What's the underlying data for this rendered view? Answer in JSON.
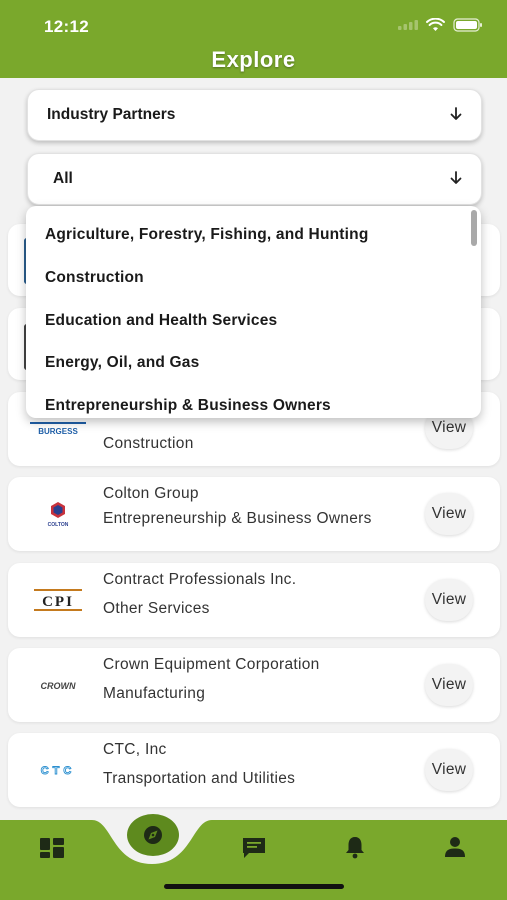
{
  "status": {
    "time": "12:12"
  },
  "header": {
    "title": "Explore"
  },
  "filters": {
    "type_select": {
      "value": "Industry Partners"
    },
    "category_select": {
      "value": "All"
    }
  },
  "dropdown": {
    "options": [
      "Agriculture, Forestry, Fishing, and Hunting",
      "Construction",
      "Education and Health Services",
      "Energy, Oil, and Gas",
      "Entrepreneurship & Business Owners"
    ]
  },
  "partners": [
    {
      "name": "",
      "industry": "Construction",
      "logo": "BURGESS",
      "view": "View"
    },
    {
      "name": "Colton Group",
      "industry": "Entrepreneurship & Business Owners",
      "logo": "COLTON",
      "view": "View"
    },
    {
      "name": "Contract Professionals Inc.",
      "industry": "Other Services",
      "logo": "CPI",
      "view": "View"
    },
    {
      "name": "Crown Equipment Corporation",
      "industry": "Manufacturing",
      "logo": "CROWN",
      "view": "View"
    },
    {
      "name": "CTC, Inc",
      "industry": "Transportation and Utilities",
      "logo": "CTC",
      "view": "View"
    }
  ],
  "tabbar": {
    "accent": "#7aa82c",
    "tabs": [
      "dashboard-icon",
      "compass-icon",
      "chat-icon",
      "bell-icon",
      "profile-icon"
    ],
    "active_tab": "compass-icon"
  },
  "colors": {
    "brand": "#7aa82c",
    "active_tab_bg": "#5e8a1e"
  }
}
